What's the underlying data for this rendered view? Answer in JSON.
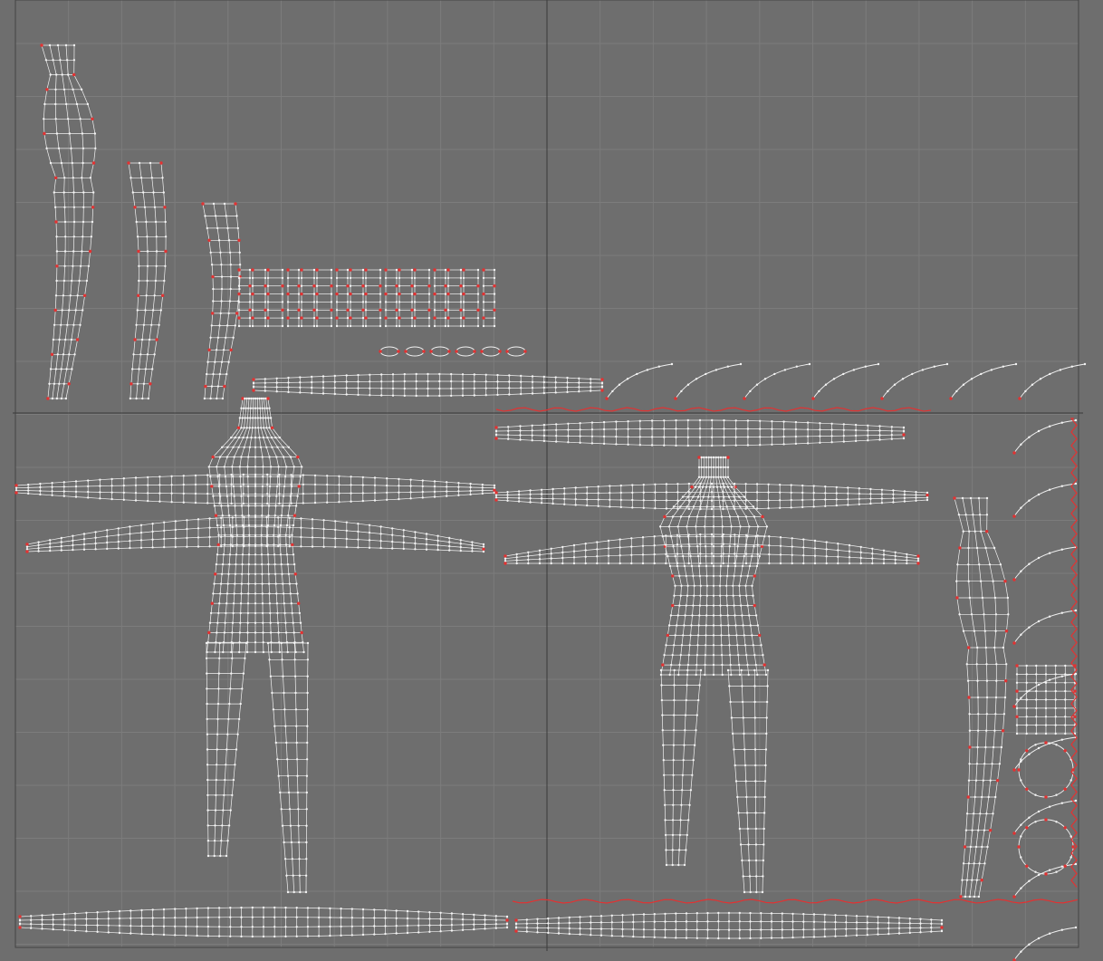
{
  "editor": {
    "view": "uv-texture-editor",
    "background_color": "#6e6e6e",
    "grid_color": "#7c7c7c",
    "axis_color": "#3a3a3a",
    "wire_color": "#f2f2f2",
    "seam_color": "#e23232",
    "grid_divisions": 20,
    "grid_visible": true
  },
  "shells": [
    {
      "id": "side-profile-left",
      "kind": "body-side"
    },
    {
      "id": "leg-side-1",
      "kind": "leg"
    },
    {
      "id": "leg-side-2",
      "kind": "leg"
    },
    {
      "id": "fingers-strip-top",
      "kind": "fingers"
    },
    {
      "id": "upper-arms-strip",
      "kind": "arms"
    },
    {
      "id": "male-body-front",
      "kind": "body"
    },
    {
      "id": "female-body-front",
      "kind": "body"
    },
    {
      "id": "side-profile-right",
      "kind": "body-side"
    },
    {
      "id": "bottom-arms-strip",
      "kind": "arms"
    },
    {
      "id": "right-edge-pieces",
      "kind": "misc"
    }
  ]
}
